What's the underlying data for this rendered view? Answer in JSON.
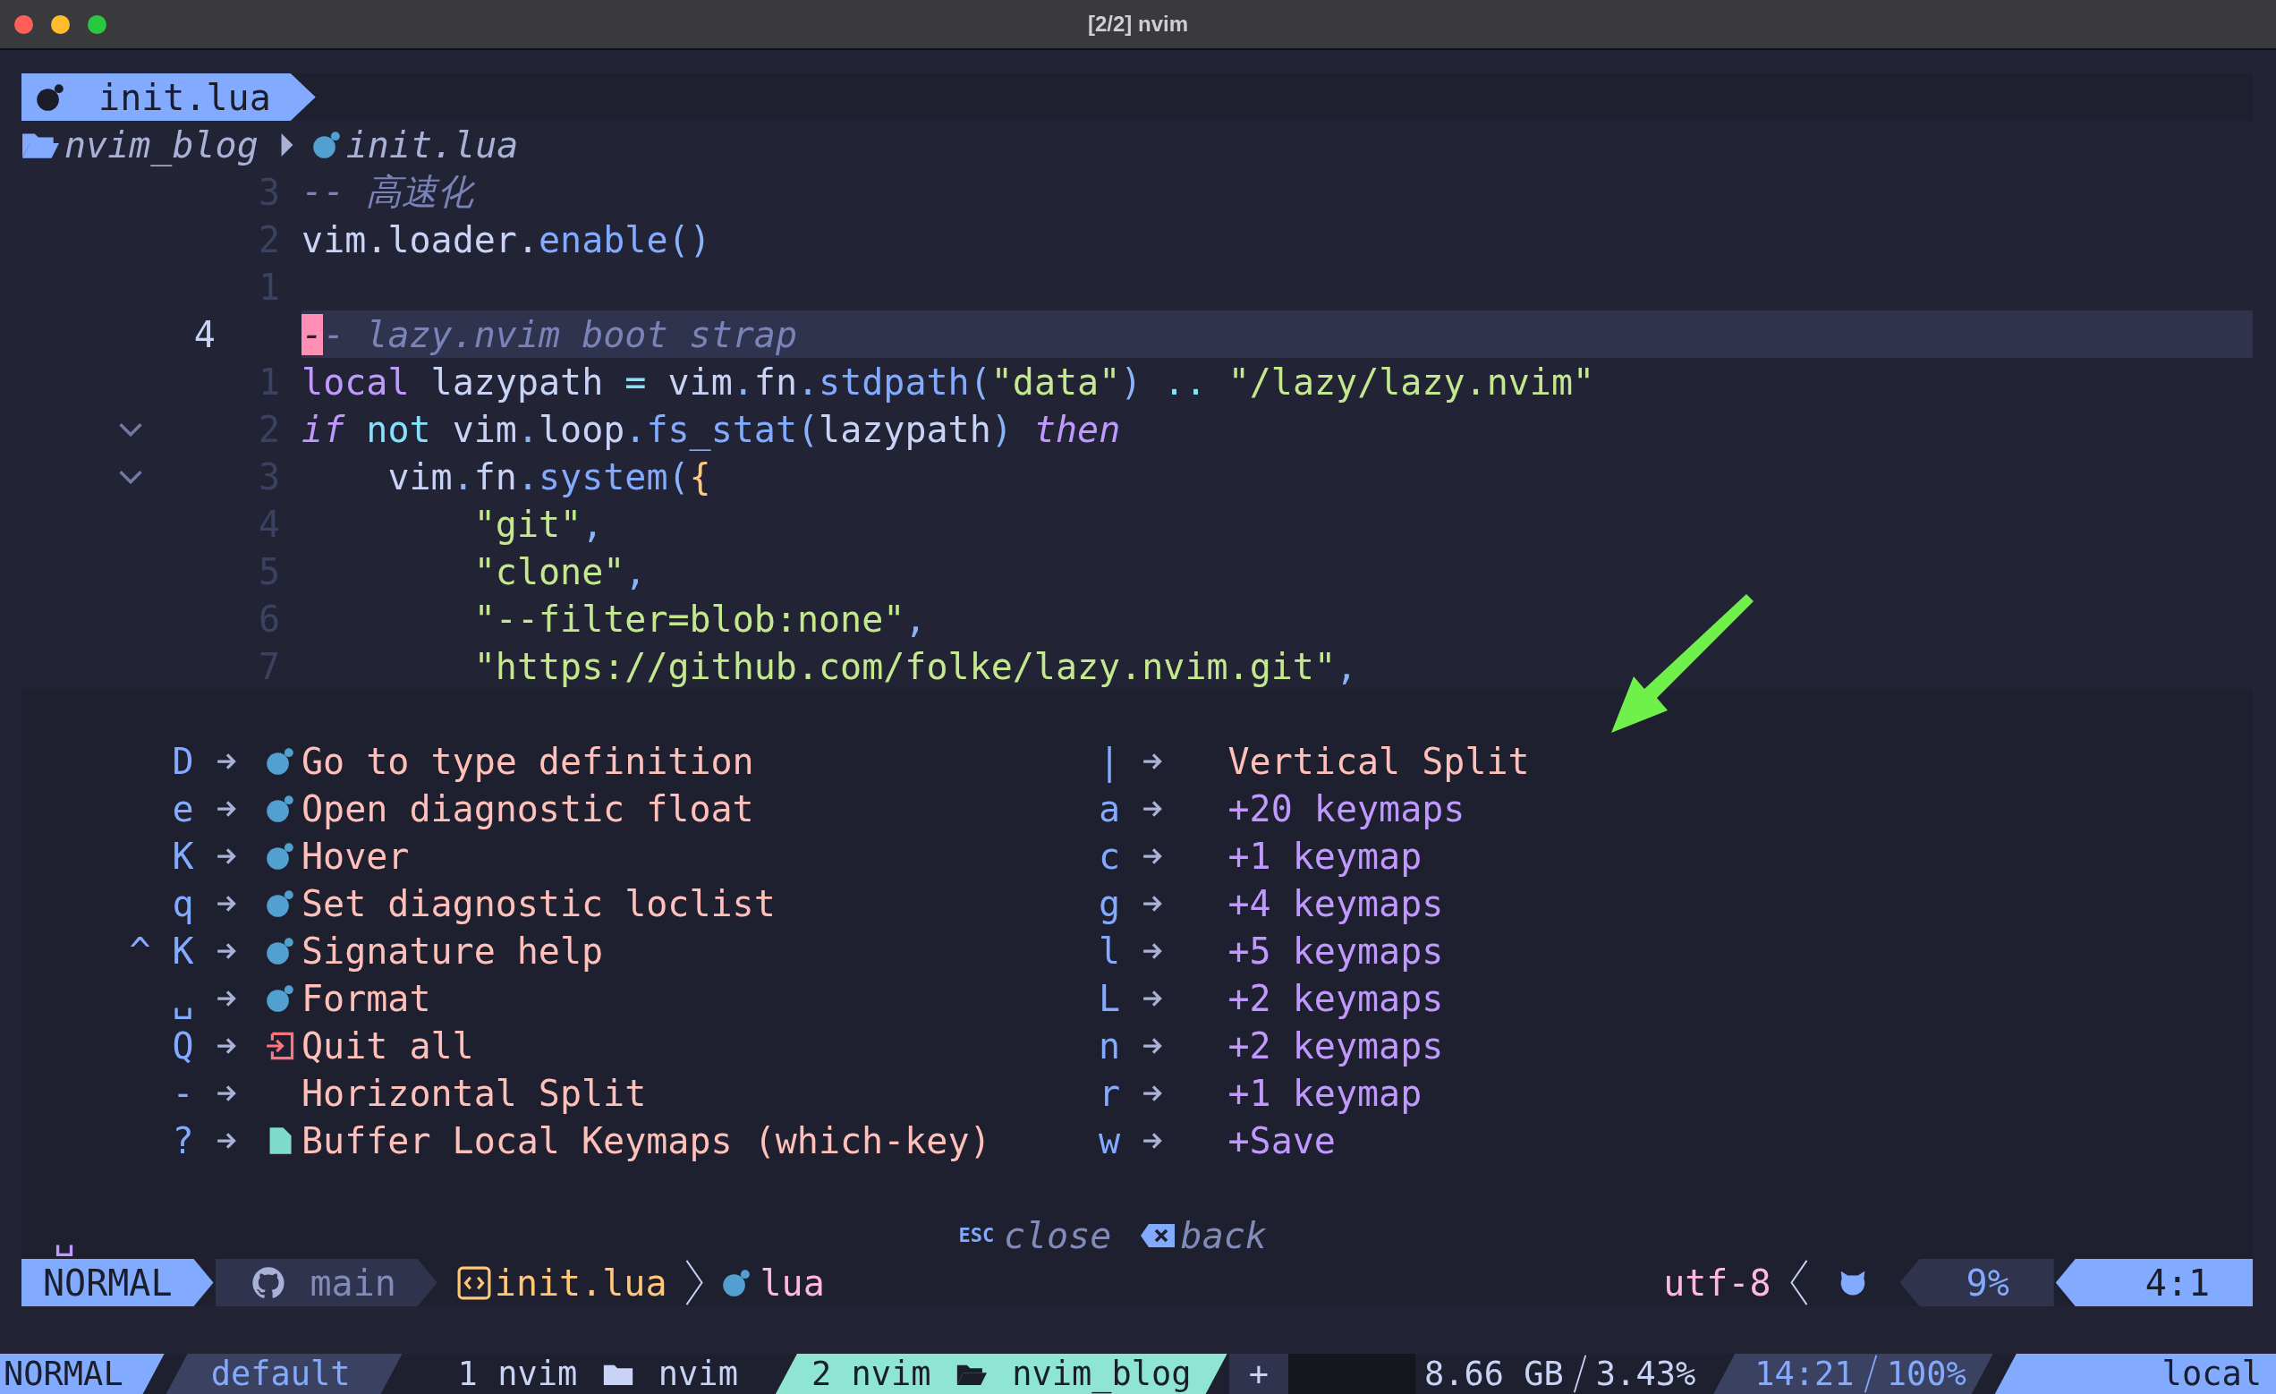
{
  "window": {
    "title": "[2/2] nvim"
  },
  "tabline": {
    "tabs": [
      {
        "label": "init.lua",
        "selected": true
      }
    ]
  },
  "winbar": {
    "folder": "nvim_blog",
    "file": "init.lua"
  },
  "editor": {
    "lines": [
      {
        "number": "3",
        "current": false,
        "fold": false,
        "tokens": [
          {
            "kind": "comment",
            "text": "-- 高速化"
          }
        ]
      },
      {
        "number": "2",
        "current": false,
        "fold": false,
        "tokens": [
          {
            "kind": "plain",
            "text": "vim.loader."
          },
          {
            "kind": "function",
            "text": "enable"
          },
          {
            "kind": "punct",
            "text": "()"
          }
        ]
      },
      {
        "number": "1",
        "current": false,
        "fold": false
      },
      {
        "number": "4",
        "current": true,
        "fold": false,
        "tokens": [
          {
            "kind": "comment",
            "text": "-- lazy.nvim boot strap"
          }
        ]
      },
      {
        "number": "1",
        "current": false,
        "fold": false,
        "tokens": [
          {
            "kind": "storage",
            "text": "local"
          },
          {
            "kind": "plain",
            "text": " lazypath "
          },
          {
            "kind": "operator",
            "text": "="
          },
          {
            "kind": "plain",
            "text": " vim"
          },
          {
            "kind": "punct",
            "text": "."
          },
          {
            "kind": "plain",
            "text": "fn"
          },
          {
            "kind": "punct",
            "text": "."
          },
          {
            "kind": "function",
            "text": "stdpath"
          },
          {
            "kind": "punct",
            "text": "("
          },
          {
            "kind": "string",
            "text": "\"data\""
          },
          {
            "kind": "punct",
            "text": ") "
          },
          {
            "kind": "operator",
            "text": ".. "
          },
          {
            "kind": "string",
            "text": "\"/lazy/lazy.nvim\""
          }
        ]
      },
      {
        "number": "2",
        "current": false,
        "fold": true,
        "tokens": [
          {
            "kind": "keyword",
            "text": "if"
          },
          {
            "kind": "operator",
            "text": " not"
          },
          {
            "kind": "plain",
            "text": " vim"
          },
          {
            "kind": "punct",
            "text": "."
          },
          {
            "kind": "plain",
            "text": "loop"
          },
          {
            "kind": "punct",
            "text": "."
          },
          {
            "kind": "function",
            "text": "fs_stat"
          },
          {
            "kind": "punct",
            "text": "("
          },
          {
            "kind": "plain",
            "text": "lazypath"
          },
          {
            "kind": "punct",
            "text": ") "
          },
          {
            "kind": "keyword",
            "text": "then"
          }
        ]
      },
      {
        "number": "3",
        "current": false,
        "fold": true,
        "tokens": [
          {
            "kind": "plain",
            "text": "    vim"
          },
          {
            "kind": "punct",
            "text": "."
          },
          {
            "kind": "plain",
            "text": "fn"
          },
          {
            "kind": "punct",
            "text": "."
          },
          {
            "kind": "function",
            "text": "system"
          },
          {
            "kind": "punct",
            "text": "("
          },
          {
            "kind": "brace",
            "text": "{"
          }
        ]
      },
      {
        "number": "4",
        "current": false,
        "fold": false,
        "tokens": [
          {
            "kind": "string",
            "text": "        \"git\""
          },
          {
            "kind": "punct",
            "text": ","
          }
        ]
      },
      {
        "number": "5",
        "current": false,
        "fold": false,
        "tokens": [
          {
            "kind": "string",
            "text": "        \"clone\""
          },
          {
            "kind": "punct",
            "text": ","
          }
        ]
      },
      {
        "number": "6",
        "current": false,
        "fold": false,
        "tokens": [
          {
            "kind": "string",
            "text": "        \"--filter=blob:none\""
          },
          {
            "kind": "punct",
            "text": ","
          }
        ]
      },
      {
        "number": "7",
        "current": false,
        "fold": false,
        "tokens": [
          {
            "kind": "string",
            "text": "        \"https://github.com/folke/lazy.nvim.git\""
          },
          {
            "kind": "punct",
            "text": ","
          }
        ]
      }
    ]
  },
  "whichkey": {
    "columns": [
      [
        {
          "key": "D",
          "kind": "lsp",
          "desc": "Go to type definition"
        },
        {
          "key": "e",
          "kind": "lsp",
          "desc": "Open diagnostic float"
        },
        {
          "key": "K",
          "kind": "lsp",
          "desc": "Hover"
        },
        {
          "key": "q",
          "kind": "lsp",
          "desc": "Set diagnostic loclist"
        },
        {
          "key": "^ K",
          "kind": "lsp",
          "desc": "Signature help"
        },
        {
          "key": "␣",
          "kind": "lsp",
          "desc": "Format"
        },
        {
          "key": "Q",
          "kind": "exit",
          "desc": "Quit all"
        },
        {
          "key": "-",
          "kind": "plain",
          "desc": "Horizontal Split"
        },
        {
          "key": "?",
          "kind": "file",
          "desc": "Buffer Local Keymaps (which-key)"
        }
      ],
      [
        {
          "key": "|",
          "kind": "plain",
          "desc": "Vertical Split"
        },
        {
          "key": "a",
          "kind": "group",
          "desc": "+20 keymaps"
        },
        {
          "key": "c",
          "kind": "group",
          "desc": "+1 keymap"
        },
        {
          "key": "g",
          "kind": "group",
          "desc": "+4 keymaps"
        },
        {
          "key": "l",
          "kind": "group",
          "desc": "+5 keymaps"
        },
        {
          "key": "L",
          "kind": "group",
          "desc": "+2 keymaps"
        },
        {
          "key": "n",
          "kind": "group",
          "desc": "+2 keymaps"
        },
        {
          "key": "r",
          "kind": "group",
          "desc": "+1 keymap"
        },
        {
          "key": "w",
          "kind": "group",
          "desc": "+Save"
        }
      ]
    ],
    "breadcrumb": "␣",
    "esc_key": "ESC",
    "close": "close",
    "back": "back"
  },
  "statusline": {
    "mode": "NORMAL",
    "branch": "main",
    "file": "init.lua",
    "filetype": "lua",
    "encoding": "utf-8",
    "progress": "9%",
    "location": "4:1"
  },
  "tmux": {
    "mode": "NORMAL",
    "session": "default",
    "windows": [
      {
        "index": "1",
        "name": "nvim",
        "dir": "nvim",
        "selected": false
      },
      {
        "index": "2",
        "name": "nvim",
        "dir": "nvim_blog",
        "selected": true
      }
    ],
    "new_window": "+",
    "memory": "8.66 GB",
    "cpu": "3.43%",
    "time": "14:21",
    "battery": "100%",
    "host": "local"
  }
}
